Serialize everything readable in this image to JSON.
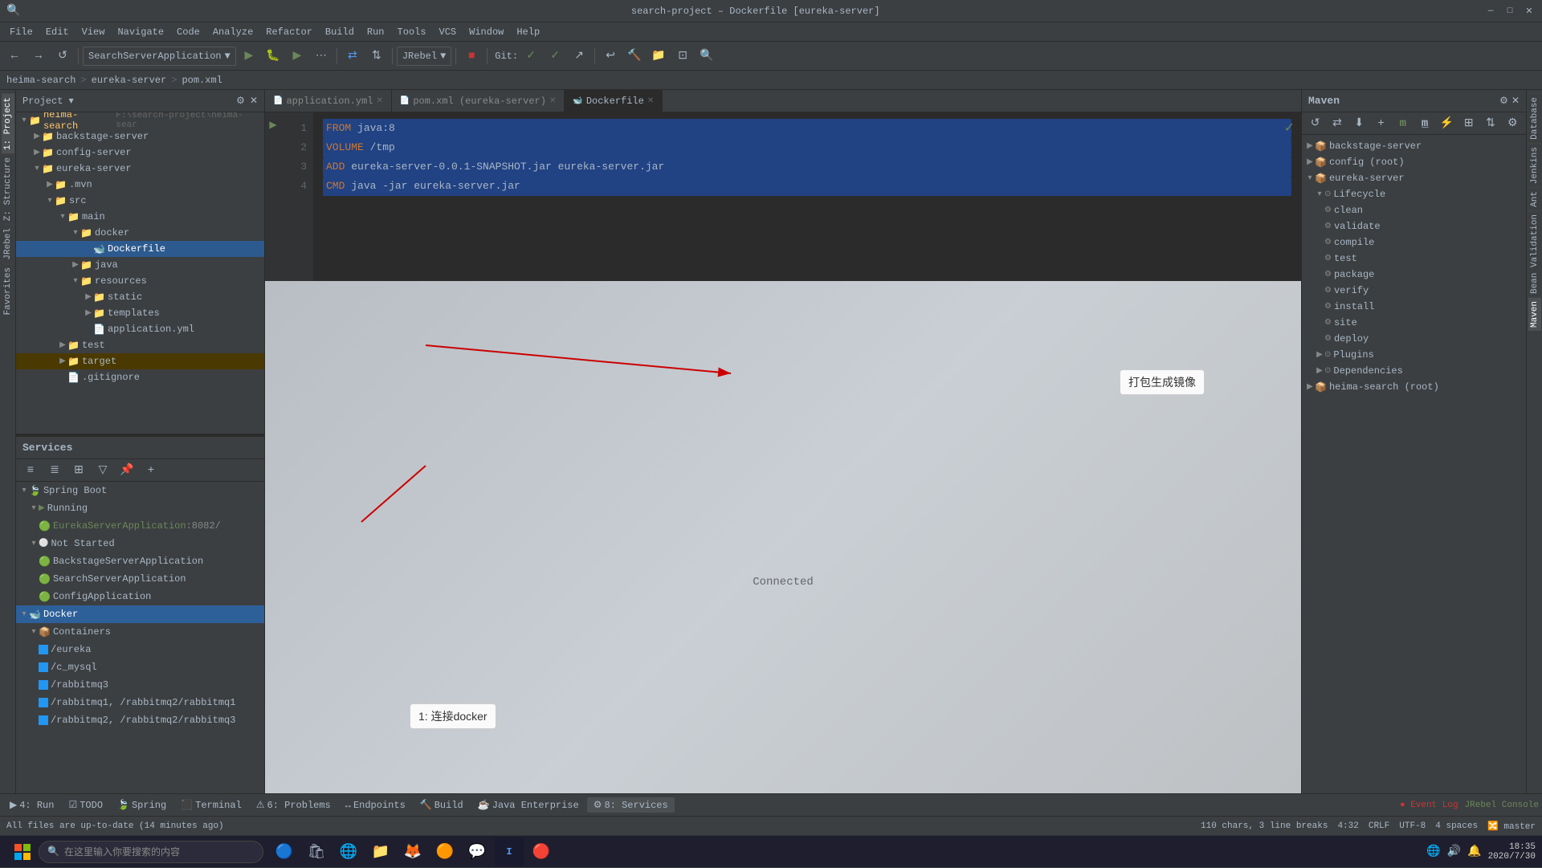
{
  "titlebar": {
    "title": "search-project – Dockerfile [eureka-server]",
    "minimize": "—",
    "maximize": "□",
    "close": "✕"
  },
  "menubar": {
    "items": [
      "File",
      "Edit",
      "View",
      "Navigate",
      "Code",
      "Analyze",
      "Refactor",
      "Build",
      "Run",
      "Tools",
      "VCS",
      "Window",
      "Help"
    ]
  },
  "toolbar": {
    "app_name": "SearchServerApplication",
    "jrebel": "JRebel",
    "git_label": "Git:"
  },
  "breadcrumb": {
    "items": [
      "heima-search",
      "eureka-server",
      "pom.xml"
    ]
  },
  "tabs": {
    "items": [
      {
        "label": "application.yml",
        "modified": false
      },
      {
        "label": "pom.xml (eureka-server)",
        "modified": false
      },
      {
        "label": "Dockerfile",
        "active": true,
        "modified": false
      }
    ]
  },
  "editor": {
    "lines": [
      {
        "num": 1,
        "content": "FROM java:8",
        "highlight": true
      },
      {
        "num": 2,
        "content": "VOLUME /tmp",
        "highlight": true
      },
      {
        "num": 3,
        "content": "ADD eureka-server-0.0.1-SNAPSHOT.jar eureka-server.jar",
        "highlight": true
      },
      {
        "num": 4,
        "content": "CMD java -jar eureka-server.jar",
        "highlight": true
      }
    ]
  },
  "annotation1": "打包生成镜像",
  "annotation2": "1: 连接docker",
  "project_tree": {
    "root": "heima-search",
    "root_path": "F:\\search-project\\heima-sear",
    "items": [
      {
        "label": "backstage-server",
        "indent": 1,
        "type": "folder"
      },
      {
        "label": "config-server",
        "indent": 1,
        "type": "folder"
      },
      {
        "label": "eureka-server",
        "indent": 1,
        "type": "folder",
        "open": true
      },
      {
        "label": ".mvn",
        "indent": 2,
        "type": "folder"
      },
      {
        "label": "src",
        "indent": 2,
        "type": "folder",
        "open": true
      },
      {
        "label": "main",
        "indent": 3,
        "type": "folder",
        "open": true
      },
      {
        "label": "docker",
        "indent": 4,
        "type": "folder",
        "open": true
      },
      {
        "label": "Dockerfile",
        "indent": 5,
        "type": "docker"
      },
      {
        "label": "java",
        "indent": 4,
        "type": "folder"
      },
      {
        "label": "resources",
        "indent": 4,
        "type": "folder",
        "open": true
      },
      {
        "label": "static",
        "indent": 5,
        "type": "folder"
      },
      {
        "label": "templates",
        "indent": 5,
        "type": "folder"
      },
      {
        "label": "application.yml",
        "indent": 5,
        "type": "yml"
      },
      {
        "label": "test",
        "indent": 3,
        "type": "folder"
      },
      {
        "label": "target",
        "indent": 3,
        "type": "folder",
        "highlight": true
      },
      {
        "label": ".gitignore",
        "indent": 3,
        "type": "file"
      }
    ]
  },
  "services": {
    "title": "Services",
    "items": [
      {
        "label": "Spring Boot",
        "indent": 0,
        "type": "group",
        "icon": "🍃"
      },
      {
        "label": "Running",
        "indent": 1,
        "type": "group",
        "icon": "▶"
      },
      {
        "label": "EurekaServerApplication :8082/",
        "indent": 2,
        "type": "app",
        "running": true
      },
      {
        "label": "Not Started",
        "indent": 1,
        "type": "group",
        "icon": ""
      },
      {
        "label": "BackstageServerApplication",
        "indent": 2,
        "type": "app"
      },
      {
        "label": "SearchServerApplication",
        "indent": 2,
        "type": "app"
      },
      {
        "label": "ConfigApplication",
        "indent": 2,
        "type": "app"
      },
      {
        "label": "Docker",
        "indent": 0,
        "type": "docker",
        "selected": true
      },
      {
        "label": "Containers",
        "indent": 1,
        "type": "group"
      },
      {
        "label": "/eureka",
        "indent": 2,
        "type": "container"
      },
      {
        "label": "/c_mysql",
        "indent": 2,
        "type": "container"
      },
      {
        "label": "/rabbitmq3",
        "indent": 2,
        "type": "container"
      },
      {
        "label": "/rabbitmq1, /rabbitmq2/rabbitmq1",
        "indent": 2,
        "type": "container"
      },
      {
        "label": "/rabbitmq2, /rabbitmq2/rabbitmq3",
        "indent": 2,
        "type": "container"
      }
    ]
  },
  "maven": {
    "title": "Maven",
    "items": [
      {
        "label": "backstage-server",
        "indent": 0,
        "type": "module"
      },
      {
        "label": "config (root)",
        "indent": 0,
        "type": "module"
      },
      {
        "label": "eureka-server",
        "indent": 0,
        "type": "module",
        "open": true
      },
      {
        "label": "Lifecycle",
        "indent": 1,
        "type": "group",
        "open": true
      },
      {
        "label": "clean",
        "indent": 2,
        "type": "goal"
      },
      {
        "label": "validate",
        "indent": 2,
        "type": "goal"
      },
      {
        "label": "compile",
        "indent": 2,
        "type": "goal"
      },
      {
        "label": "test",
        "indent": 2,
        "type": "goal"
      },
      {
        "label": "package",
        "indent": 2,
        "type": "goal"
      },
      {
        "label": "verify",
        "indent": 2,
        "type": "goal"
      },
      {
        "label": "install",
        "indent": 2,
        "type": "goal"
      },
      {
        "label": "site",
        "indent": 2,
        "type": "goal"
      },
      {
        "label": "deploy",
        "indent": 2,
        "type": "goal"
      },
      {
        "label": "Plugins",
        "indent": 1,
        "type": "group"
      },
      {
        "label": "Dependencies",
        "indent": 1,
        "type": "group"
      },
      {
        "label": "heima-search (root)",
        "indent": 0,
        "type": "module"
      }
    ]
  },
  "bottom_tabs": {
    "items": [
      {
        "label": "4: Run",
        "icon": "▶"
      },
      {
        "label": "TODO",
        "icon": "☑"
      },
      {
        "label": "Spring",
        "icon": "🍃"
      },
      {
        "label": "Terminal",
        "icon": "⬛"
      },
      {
        "label": "6: Problems",
        "icon": "⚠"
      },
      {
        "label": "Endpoints",
        "icon": "↔"
      },
      {
        "label": "Build",
        "icon": "🔨"
      },
      {
        "label": "Java Enterprise",
        "icon": "☕"
      },
      {
        "label": "8: Services",
        "icon": "⚙",
        "active": true
      }
    ]
  },
  "statusbar": {
    "message": "All files are up-to-date (14 minutes ago)",
    "chars": "110 chars, 3 line breaks",
    "position": "4:32",
    "line_sep": "CRLF",
    "encoding": "UTF-8",
    "indent": "4 spaces",
    "branch": "master",
    "event_log": "Event Log",
    "jrebel_console": "JRebel Console"
  },
  "connected": "Connected",
  "taskbar": {
    "search_placeholder": "在这里输入你要搜索的内容",
    "time": "18:35",
    "date": "2020/7/30"
  },
  "side_tabs_left": [
    "1: Project",
    "Z: Structure",
    "JRebel",
    "Favorites"
  ],
  "side_tabs_right": [
    "Database",
    "Jenkins",
    "Ant",
    "Bean Validation",
    "Maven"
  ]
}
